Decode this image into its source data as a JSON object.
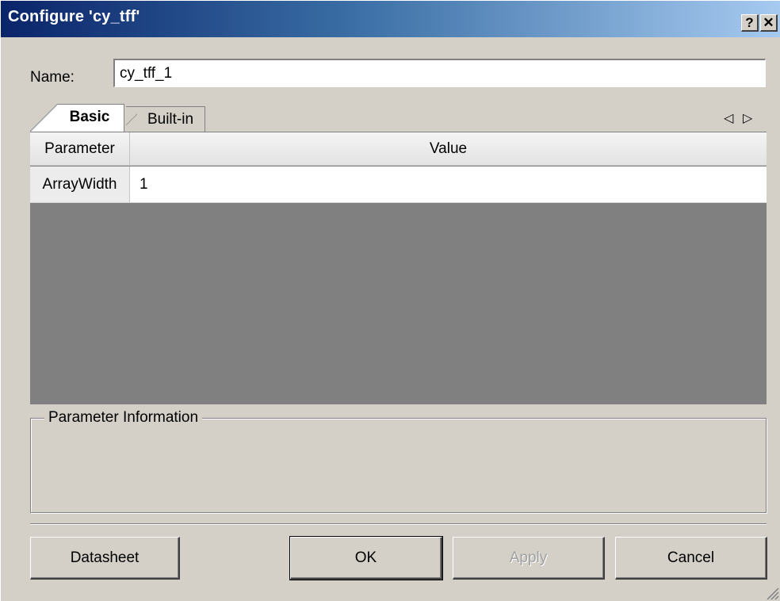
{
  "window": {
    "title": "Configure 'cy_tff'",
    "help_label": "?",
    "close_label": "✕",
    "colors": {
      "titlebar_start": "#0a246a",
      "titlebar_end": "#a6caf0",
      "face": "#d4d0c8",
      "grid_empty": "#808080"
    }
  },
  "name_field": {
    "label": "Name:",
    "value": "cy_tff_1"
  },
  "tabs": [
    {
      "label": "Basic",
      "active": true
    },
    {
      "label": "Built-in",
      "active": false
    }
  ],
  "tab_scroll": {
    "left_glyph": "◁",
    "right_glyph": "▷"
  },
  "grid": {
    "headers": [
      "Parameter",
      "Value"
    ],
    "rows": [
      {
        "parameter": "ArrayWidth",
        "value": "1"
      }
    ]
  },
  "info_group": {
    "label": "Parameter Information"
  },
  "buttons": {
    "datasheet": "Datasheet",
    "ok": "OK",
    "apply": "Apply",
    "cancel": "Cancel"
  }
}
